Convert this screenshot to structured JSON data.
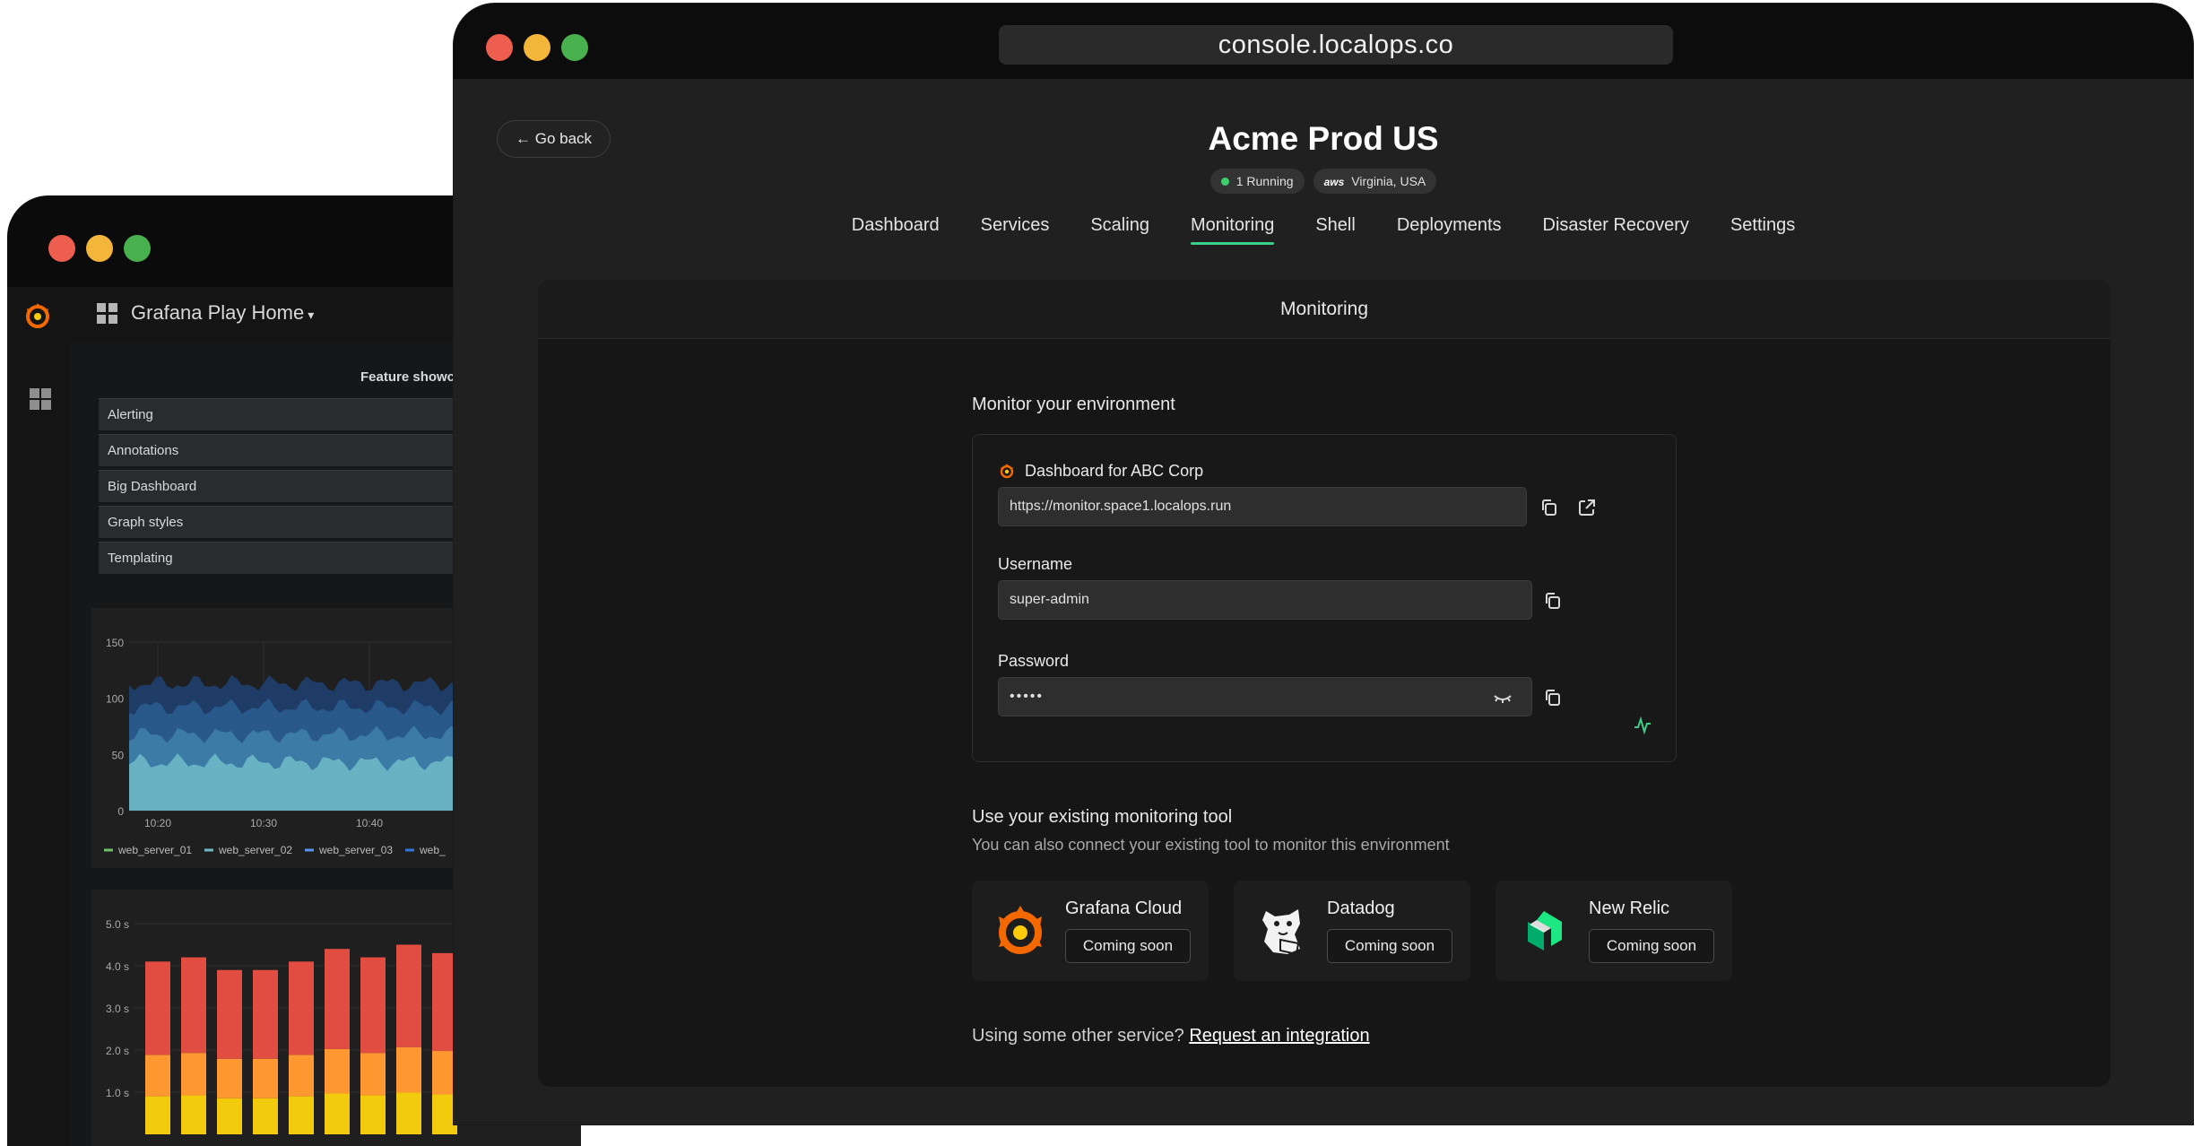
{
  "grafana": {
    "title": "Grafana Play Home",
    "showcase_label": "Feature showca",
    "list_items": [
      "Alerting",
      "Annotations",
      "Big Dashboard",
      "Graph styles",
      "Templating"
    ],
    "panel1": {
      "y_ticks": [
        "150",
        "100",
        "50",
        "0"
      ],
      "x_ticks": [
        "10:20",
        "10:30",
        "10:40"
      ],
      "legend": [
        "web_server_01",
        "web_server_02",
        "web_server_03",
        "web_"
      ]
    },
    "panel2": {
      "y_ticks": [
        "5.0 s",
        "4.0 s",
        "3.0 s",
        "2.0 s",
        "1.0 s"
      ],
      "bars": [
        4.1,
        4.2,
        3.9,
        3.9,
        4.1,
        4.4,
        4.2,
        4.5,
        4.3
      ]
    }
  },
  "browser": {
    "url": "console.localops.co"
  },
  "header": {
    "back_label": "← Go back",
    "env_title": "Acme Prod US",
    "status_badge": "1 Running",
    "region_provider": "aws",
    "region_badge": "Virginia, USA"
  },
  "nav": {
    "tabs": [
      "Dashboard",
      "Services",
      "Scaling",
      "Monitoring",
      "Shell",
      "Deployments",
      "Disaster Recovery",
      "Settings"
    ],
    "active": "Monitoring"
  },
  "card": {
    "title": "Monitoring",
    "monitor_heading": "Monitor your environment",
    "dashboard_label": "Dashboard for ABC Corp",
    "dashboard_url": "https://monitor.space1.localops.run",
    "username_label": "Username",
    "username_value": "super-admin",
    "password_label": "Password",
    "password_value": "•••••",
    "existing_heading": "Use your existing monitoring tool",
    "existing_sub": "You can also connect your existing tool to monitor this environment",
    "tools": [
      {
        "name": "Grafana Cloud",
        "button": "Coming soon"
      },
      {
        "name": "Datadog",
        "button": "Coming soon"
      },
      {
        "name": "New Relic",
        "button": "Coming soon"
      }
    ],
    "other_text": "Using some other service?",
    "request_link": "Request an integration"
  },
  "colors": {
    "accent_green": "#3ccf8a",
    "grafana_orange": "#f46800",
    "newrelic_green": "#1ce783"
  }
}
